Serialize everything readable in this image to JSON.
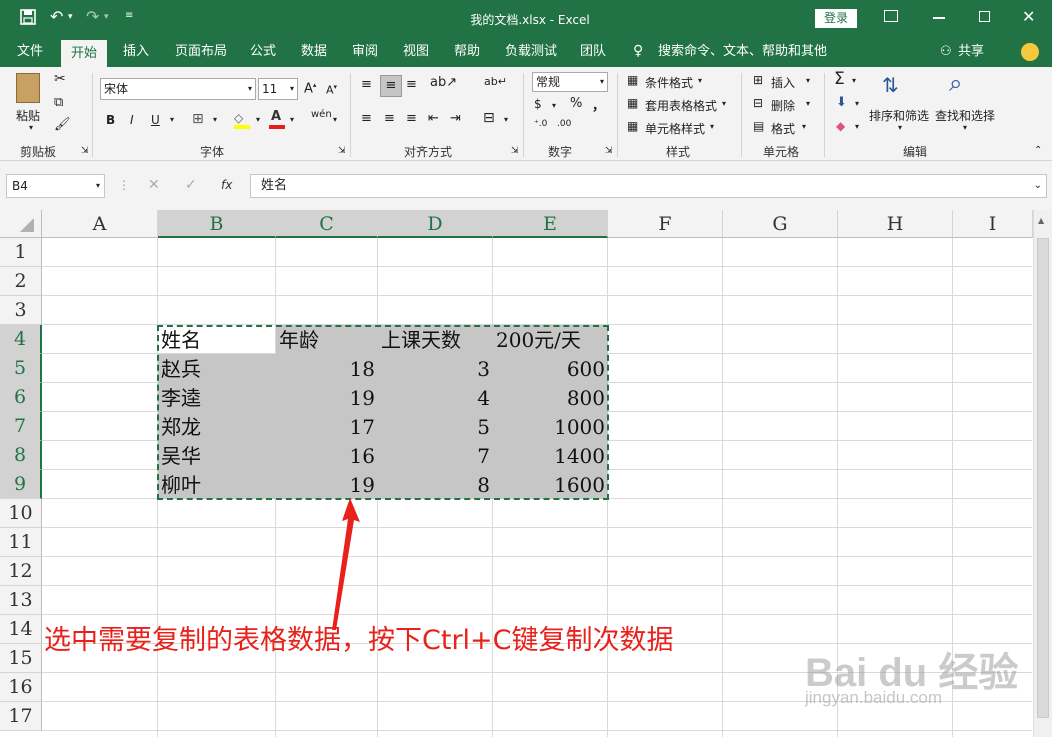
{
  "window": {
    "title": "我的文档.xlsx  -  Excel",
    "login_label": "登录",
    "controls": [
      "restore-window-icon",
      "minimize-icon",
      "maximize-icon",
      "close-icon"
    ]
  },
  "quick_access": [
    "save-icon",
    "undo-icon",
    "redo-icon",
    "customize-icon"
  ],
  "tabs": [
    {
      "label": "文件"
    },
    {
      "label": "开始",
      "active": true
    },
    {
      "label": "插入"
    },
    {
      "label": "页面布局"
    },
    {
      "label": "公式"
    },
    {
      "label": "数据"
    },
    {
      "label": "审阅"
    },
    {
      "label": "视图"
    },
    {
      "label": "帮助"
    },
    {
      "label": "负载测试"
    },
    {
      "label": "团队"
    }
  ],
  "tell_me": "搜索命令、文本、帮助和其他",
  "share_label": "共享",
  "ribbon": {
    "clipboard": {
      "paste": "粘贴",
      "group": "剪贴板"
    },
    "font": {
      "name": "宋体",
      "size": "11",
      "bold": "B",
      "italic": "I",
      "underline": "U",
      "group": "字体"
    },
    "alignment": {
      "group": "对齐方式"
    },
    "number": {
      "format": "常规",
      "percent": "%",
      "comma": "，",
      "group": "数字"
    },
    "styles": {
      "conditional": "条件格式",
      "table": "套用表格格式",
      "cell": "单元格样式",
      "group": "样式"
    },
    "cells": {
      "insert": "插入",
      "delete": "删除",
      "format": "格式",
      "group": "单元格"
    },
    "editing": {
      "sort": "排序和筛选",
      "find": "查找和选择",
      "group": "编辑"
    }
  },
  "formula_bar": {
    "name_box": "B4",
    "fx": "fx",
    "value": "姓名"
  },
  "columns": [
    "A",
    "B",
    "C",
    "D",
    "E",
    "F",
    "G",
    "H",
    "I"
  ],
  "rows": [
    "1",
    "2",
    "3",
    "4",
    "5",
    "6",
    "7",
    "8",
    "9",
    "10",
    "11",
    "12",
    "13",
    "14",
    "15",
    "16",
    "17"
  ],
  "table": {
    "header": [
      "姓名",
      "年龄",
      "上课天数",
      "200元/天"
    ],
    "rows": [
      [
        "赵兵",
        "18",
        "3",
        "600"
      ],
      [
        "李逵",
        "19",
        "4",
        "800"
      ],
      [
        "郑龙",
        "17",
        "5",
        "1000"
      ],
      [
        "吴华",
        "16",
        "7",
        "1400"
      ],
      [
        "柳叶",
        "19",
        "8",
        "1600"
      ]
    ]
  },
  "annotation": {
    "text": "选中需要复制的表格数据，按下Ctrl+C键复制次数据",
    "color": "#e8221b"
  },
  "watermark": {
    "brand": "Bai du 经验",
    "url": "jingyan.baidu.com"
  },
  "colors": {
    "accent": "#217346",
    "selection": "#c6c6c6"
  }
}
